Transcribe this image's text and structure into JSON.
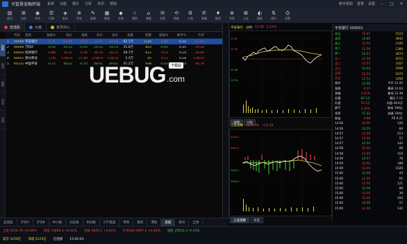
{
  "app": {
    "title": "大智慧金融终端",
    "menus": [
      "系统",
      "功能",
      "报价",
      "分析",
      "资讯",
      "帮助"
    ],
    "title_right": [
      "新手帮助",
      "登录",
      "设置"
    ]
  },
  "toolbar": {
    "items": [
      {
        "icon": "▤",
        "label": "首页"
      },
      {
        "icon": "⊞",
        "label": "自选"
      },
      {
        "icon": "◉",
        "label": "市场"
      },
      {
        "icon": "☰",
        "label": "行情"
      },
      {
        "icon": "◈",
        "label": "板块"
      },
      {
        "icon": "⊕",
        "label": "资金"
      },
      {
        "icon": "✎",
        "label": "新闻"
      },
      {
        "icon": "▦",
        "label": "数据"
      },
      {
        "icon": "◆",
        "label": "交易"
      },
      {
        "icon": "☆",
        "label": "理财"
      },
      {
        "icon": "⌂",
        "label": "港股"
      },
      {
        "icon": "✉",
        "label": "消息"
      },
      {
        "icon": "⟲",
        "label": "刷新"
      },
      {
        "icon": "⚙",
        "label": "工具"
      },
      {
        "icon": "✆",
        "label": "客服"
      },
      {
        "icon": "♦",
        "label": "推荐"
      },
      {
        "icon": "⊗",
        "label": "专家"
      },
      {
        "icon": "⊠",
        "label": "公告"
      },
      {
        "icon": "◐",
        "label": "指标"
      },
      {
        "icon": "⇅",
        "label": "排行"
      },
      {
        "icon": "⛭",
        "label": "设置"
      }
    ]
  },
  "tabs": [
    {
      "label": "自选股",
      "color": "#e04040"
    },
    {
      "label": "大盘",
      "color": "#3a7ae0"
    },
    {
      "label": "资讯中心",
      "color": "#e0b030"
    }
  ],
  "sidebar_tabs": [
    "自选",
    "板块",
    "指数",
    "资金",
    "全部"
  ],
  "table": {
    "headers": [
      "",
      "代码",
      "名称",
      "涨幅%",
      "现价",
      "涨跌",
      "买价",
      "卖价",
      "总量",
      "现量",
      "涨速%",
      "换手%",
      "今开"
    ],
    "rows": [
      [
        "1",
        "000001",
        "平安银行",
        "1.21",
        "12.56",
        "0.15",
        "12.55",
        "12.56",
        "62.1万",
        "1526",
        "0.08",
        "0.32",
        "12.42"
      ],
      [
        "2",
        "000002",
        "万科A",
        "-0.52",
        "19.13",
        "-0.10",
        "19.12",
        "19.13",
        "35.8万",
        "843",
        "-0.05",
        "0.35",
        "19.20"
      ],
      [
        "3",
        "600036",
        "招商银行",
        "0.88",
        "34.25",
        "0.30",
        "34.24",
        "34.25",
        "28.7万",
        "612",
        "0.03",
        "0.14",
        "34.00"
      ],
      [
        "4",
        "600519",
        "贵州茅台",
        "1.56",
        "1785.0",
        "27.40",
        "1784.9",
        "1785.0",
        "2.3万",
        "45",
        "0.12",
        "0.18",
        "1760.0"
      ],
      [
        "5",
        "601318",
        "中国平安",
        "-0.21",
        "48.62",
        "-0.10",
        "48.61",
        "48.62",
        "41.2万",
        "938",
        "-0.02",
        "0.23",
        "48.70"
      ]
    ]
  },
  "watermark": {
    "main": "UEBUG",
    "badge": "下载站",
    "suffix": ".com"
  },
  "chart1": {
    "header": [
      "平安银行",
      "分时",
      "12.56",
      "1.21%"
    ],
    "subtabs": [
      "分时",
      "K线"
    ]
  },
  "chart2": {
    "header": [
      "上证指数",
      "3456.78",
      "+12.34"
    ],
    "subtabs": [
      "上证指数",
      "深证"
    ]
  },
  "right_panel": {
    "title": "平安银行 000001",
    "rows": [
      [
        "卖五",
        "12.61",
        "1523"
      ],
      [
        "卖四",
        "12.60",
        "3842"
      ],
      [
        "卖三",
        "12.59",
        "2106"
      ],
      [
        "卖二",
        "12.58",
        "1389"
      ],
      [
        "卖一",
        "12.57",
        "2874"
      ],
      [
        "买一",
        "12.56",
        "4215"
      ],
      [
        "买二",
        "12.55",
        "3167"
      ],
      [
        "买三",
        "12.54",
        "2598"
      ],
      [
        "买四",
        "12.53",
        "1874"
      ],
      [
        "买五",
        "12.52",
        "3356"
      ],
      [
        "现价",
        "12.56",
        "今开 12.42"
      ],
      [
        "涨跌",
        "0.15",
        "最高 12.63"
      ],
      [
        "涨幅",
        "1.21%",
        "最低 12.38"
      ],
      [
        "总量",
        "62.1万",
        "量比 1.12"
      ],
      [
        "外盘",
        "33.5万",
        "内盘 28.6万"
      ],
      [
        "换手",
        "0.32%",
        "股本 194亿"
      ],
      [
        "净资",
        "17.33",
        "流通 194亿"
      ],
      [
        "收益",
        "0.68",
        "PE 9.21"
      ],
      [
        "14:56",
        "12.56",
        "126"
      ],
      [
        "14:56",
        "12.55",
        "84"
      ],
      [
        "14:57",
        "12.56",
        "213"
      ],
      [
        "14:57",
        "12.56",
        "57"
      ],
      [
        "14:57",
        "12.55",
        "142"
      ],
      [
        "14:58",
        "12.56",
        "98"
      ],
      [
        "14:58",
        "12.56",
        "310"
      ],
      [
        "14:59",
        "12.57",
        "76"
      ],
      [
        "14:59",
        "12.56",
        "188"
      ],
      [
        "15:00",
        "12.56",
        "1526"
      ],
      [
        "15:00",
        "12.56",
        "43"
      ],
      [
        "15:00",
        "12.56",
        "65"
      ],
      [
        "15:00",
        "12.56",
        "121"
      ],
      [
        "15:00",
        "12.56",
        "88"
      ],
      [
        "15:00",
        "12.56",
        "39"
      ],
      [
        "15:00",
        "12.56",
        "204"
      ],
      [
        "15:00",
        "12.56",
        "57"
      ],
      [
        "15:00",
        "12.56",
        "132"
      ]
    ]
  },
  "bottom_tabs": [
    "自选股",
    "沪深A",
    "沪深B",
    "中小板",
    "创业板",
    "科创板",
    "ETF基金",
    "债券",
    "期货",
    "港股",
    "美股",
    "板块",
    "全球"
  ],
  "status": {
    "line1": [
      "上证 3456.78 +0.36%",
      "深证 13892.4 +0.52%",
      "创业 2845.1 +0.81%",
      "沪深300 4987.2 +0.44%",
      "恒生 25012.3 -0.15%"
    ],
    "line2": [
      "成交 3256亿",
      "深成 4123亿",
      "已连接",
      "15:00:03"
    ]
  }
}
